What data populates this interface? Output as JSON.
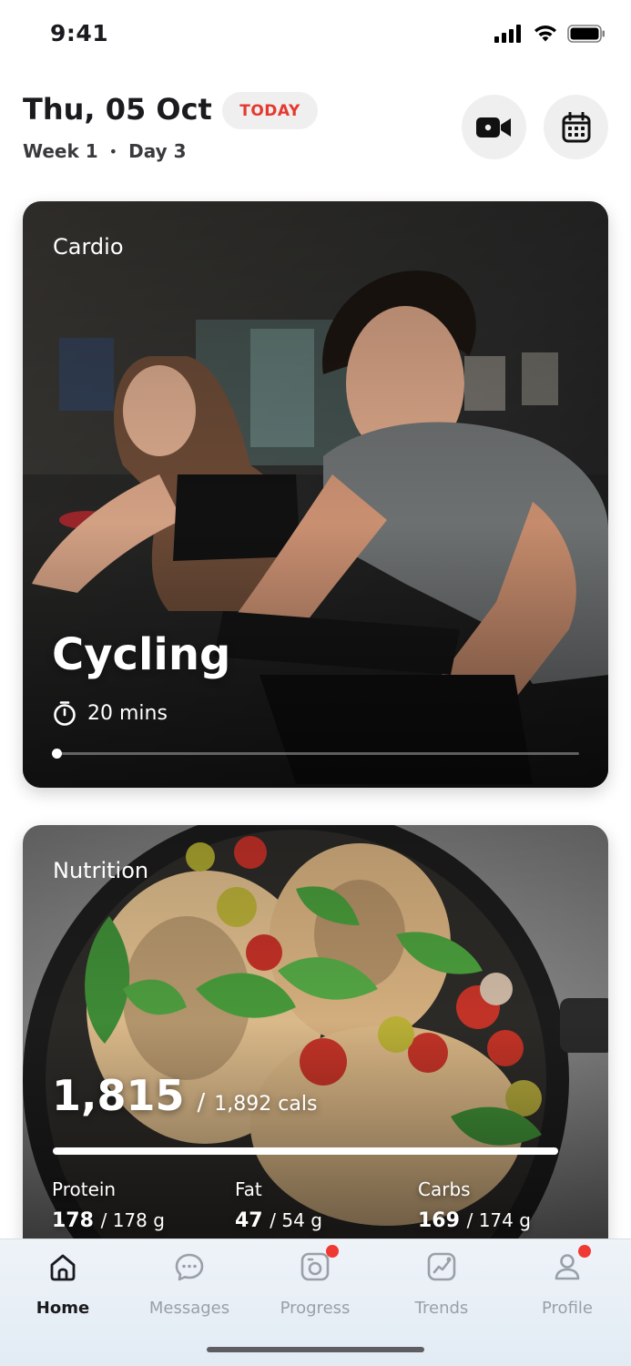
{
  "status_bar": {
    "time": "9:41"
  },
  "header": {
    "date": "Thu, 05 Oct",
    "badge": "TODAY",
    "week": "Week 1",
    "separator": "•",
    "day": "Day 3",
    "icons": [
      "video-camera-icon",
      "calendar-icon"
    ]
  },
  "cardio": {
    "label": "Cardio",
    "title": "Cycling",
    "duration": "20 mins",
    "progress": 0.0
  },
  "nutrition": {
    "label": "Nutrition",
    "calories_eaten": "1,815",
    "calories_separator": "/",
    "calories_goal": "1,892 cals",
    "progress": 0.96,
    "macros": [
      {
        "label": "Protein",
        "value": "178",
        "goal": "/ 178 g"
      },
      {
        "label": "Fat",
        "value": "47",
        "goal": "/ 54 g"
      },
      {
        "label": "Carbs",
        "value": "169",
        "goal": "/ 174 g"
      }
    ]
  },
  "nav": [
    {
      "label": "Home",
      "icon": "home-icon",
      "active": true,
      "badge": false
    },
    {
      "label": "Messages",
      "icon": "chat-icon",
      "active": false,
      "badge": false
    },
    {
      "label": "Progress",
      "icon": "progress-icon",
      "active": false,
      "badge": true
    },
    {
      "label": "Trends",
      "icon": "trends-icon",
      "active": false,
      "badge": false
    },
    {
      "label": "Profile",
      "icon": "profile-icon",
      "active": false,
      "badge": true
    }
  ],
  "colors": {
    "accent_red": "#e5392f",
    "badge_dot": "#ef3a34",
    "nav_active": "#1b1b1f",
    "nav_inactive": "#9aa0a8"
  }
}
